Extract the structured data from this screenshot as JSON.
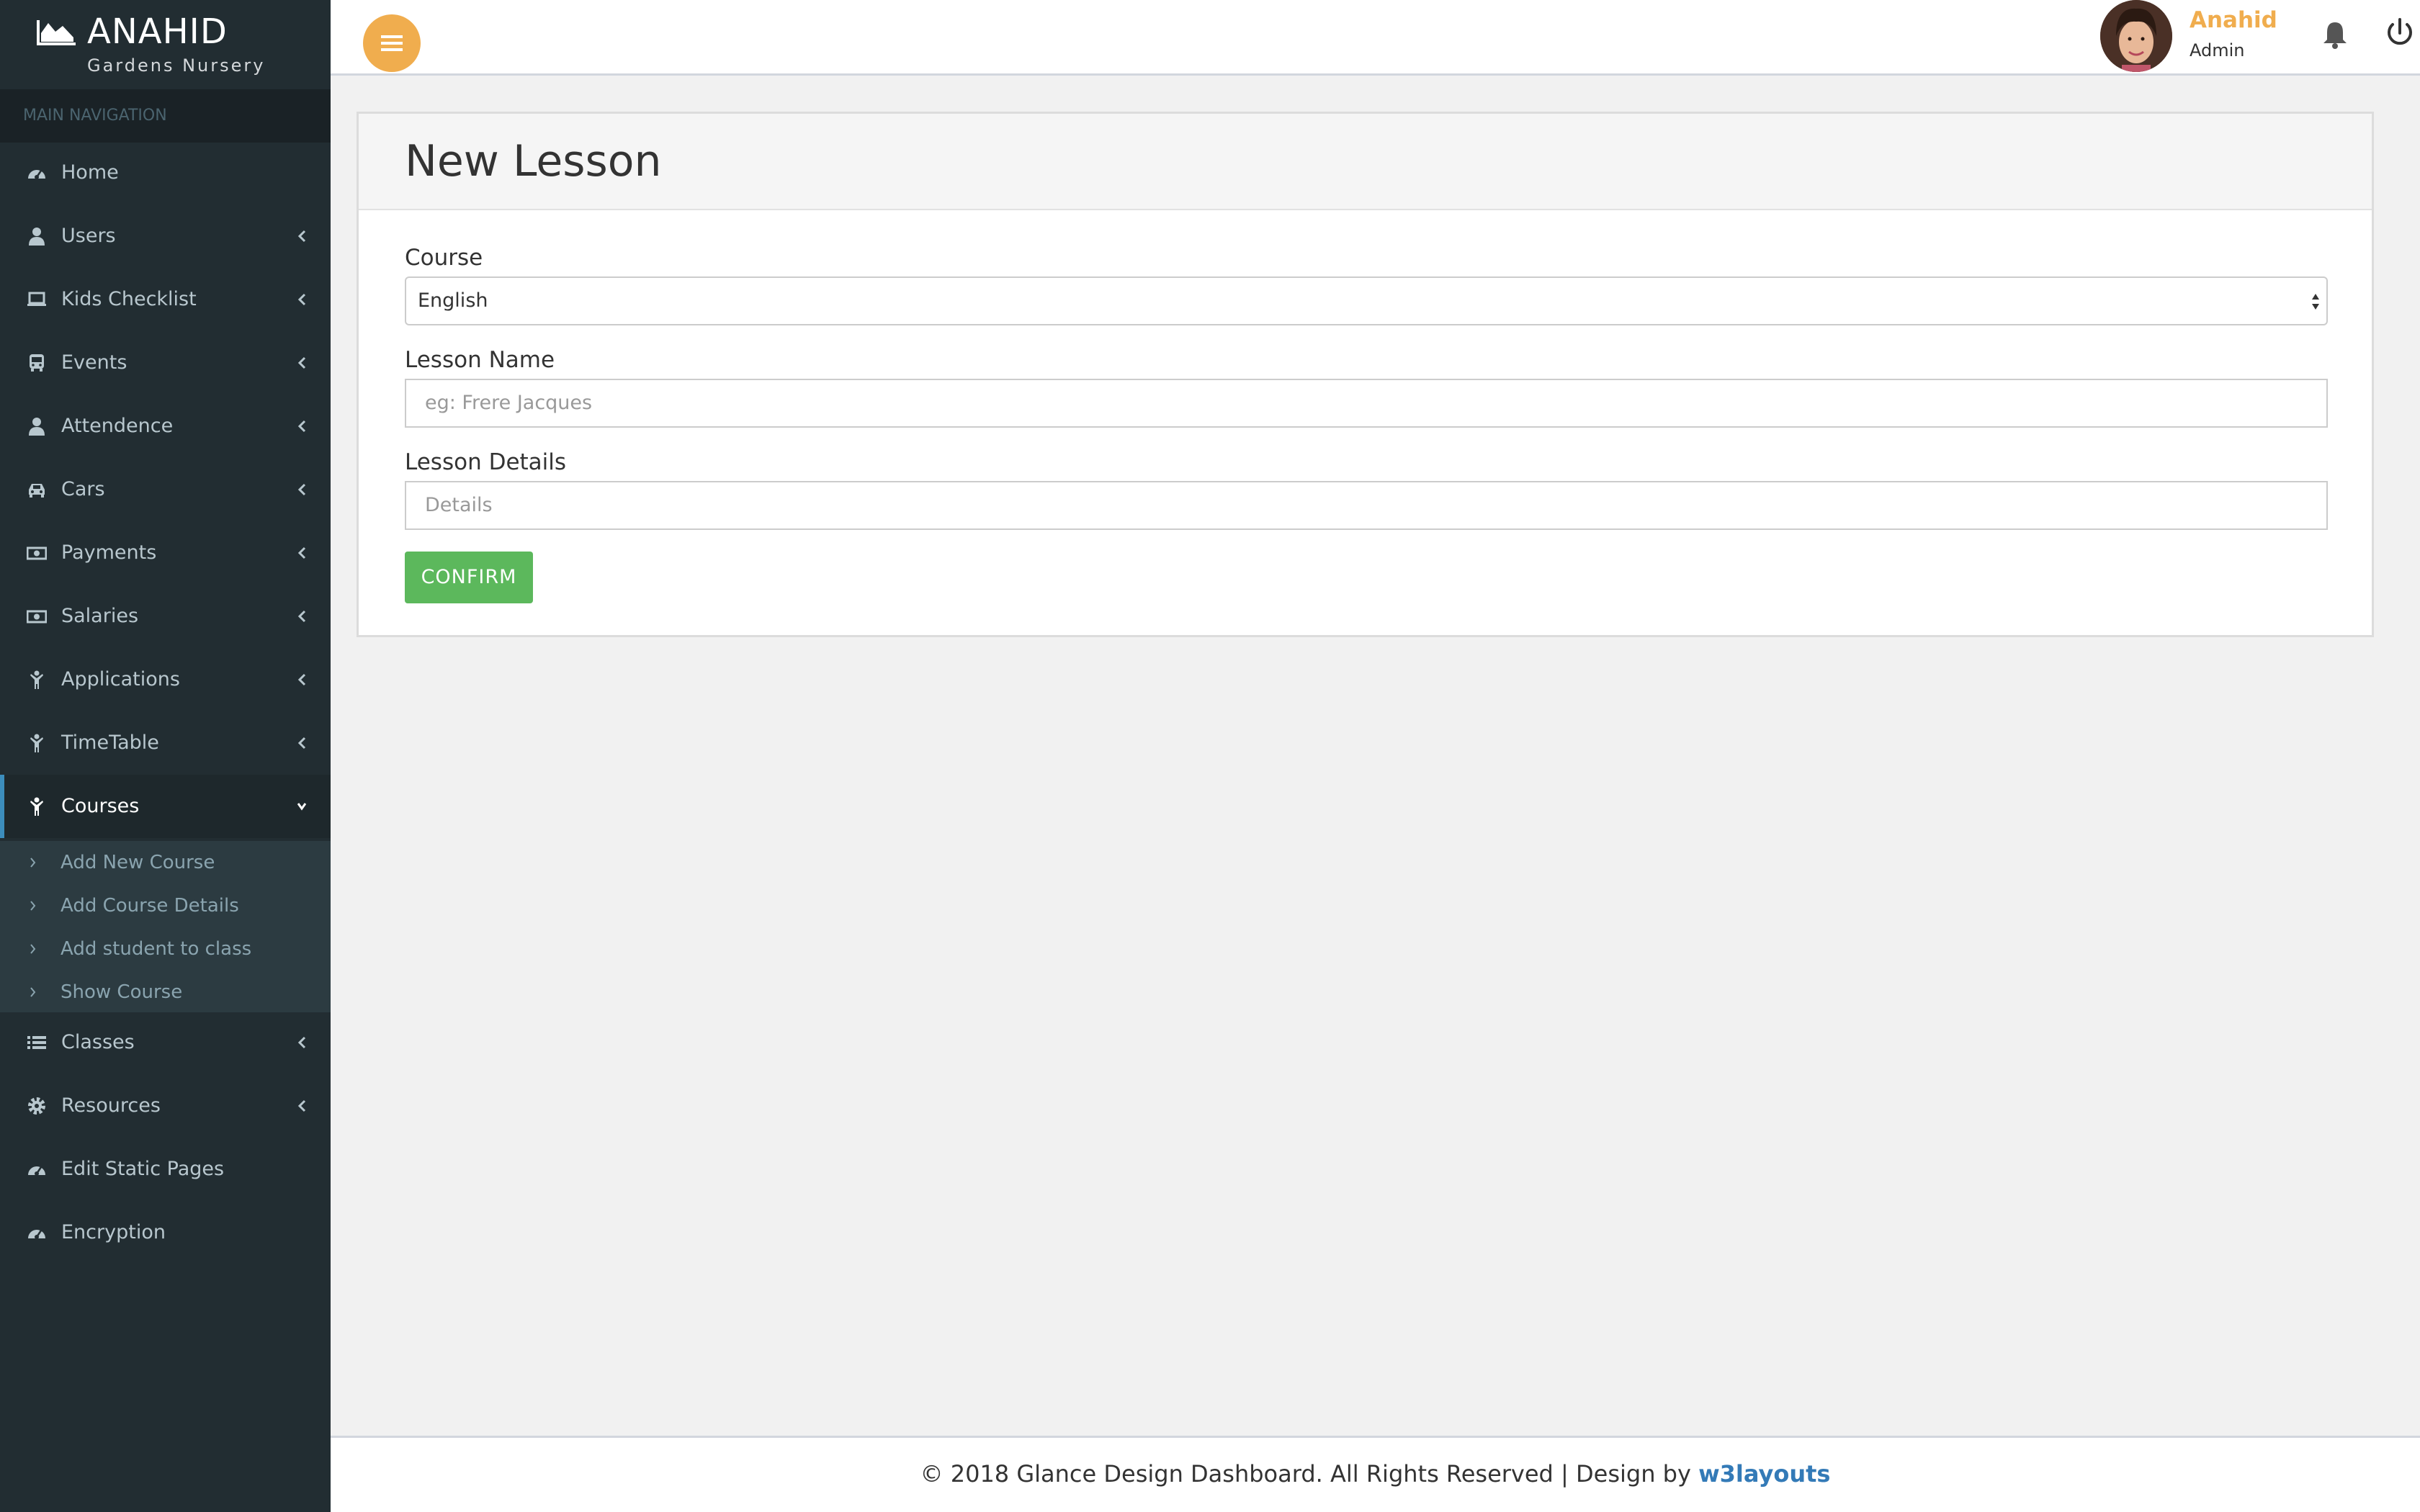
{
  "brand": {
    "name": "ANAHID",
    "subtitle": "Gardens Nursery"
  },
  "sidebar": {
    "header": "MAIN NAVIGATION",
    "items": [
      {
        "label": "Home",
        "icon": "dashboard-icon"
      },
      {
        "label": "Users",
        "icon": "user-icon"
      },
      {
        "label": "Kids Checklist",
        "icon": "laptop-icon"
      },
      {
        "label": "Events",
        "icon": "bus-icon"
      },
      {
        "label": "Attendence",
        "icon": "user-icon"
      },
      {
        "label": "Cars",
        "icon": "car-icon"
      },
      {
        "label": "Payments",
        "icon": "money-icon"
      },
      {
        "label": "Salaries",
        "icon": "money-icon"
      },
      {
        "label": "Applications",
        "icon": "child-icon"
      },
      {
        "label": "TimeTable",
        "icon": "child-icon"
      },
      {
        "label": "Courses",
        "icon": "child-icon"
      },
      {
        "label": "Classes",
        "icon": "list-icon"
      },
      {
        "label": "Resources",
        "icon": "gear-icon"
      },
      {
        "label": "Edit Static Pages",
        "icon": "dashboard-icon"
      },
      {
        "label": "Encryption",
        "icon": "dashboard-icon"
      }
    ],
    "courses_submenu": [
      {
        "label": "Add New Course"
      },
      {
        "label": "Add Course Details"
      },
      {
        "label": "Add student to class"
      },
      {
        "label": "Show Course"
      }
    ]
  },
  "topbar": {
    "user_name": "Anahid",
    "user_role": "Admin",
    "colors": {
      "accent": "#f0ad4e"
    }
  },
  "form": {
    "title": "New Lesson",
    "course_label": "Course",
    "course_value": "English",
    "lesson_name_label": "Lesson Name",
    "lesson_name_placeholder": "eg: Frere Jacques",
    "lesson_details_label": "Lesson Details",
    "lesson_details_placeholder": "Details",
    "confirm_label": "CONFIRM"
  },
  "footer": {
    "text": "© 2018 Glance Design Dashboard. All Rights Reserved | Design by ",
    "link": "w3layouts"
  }
}
